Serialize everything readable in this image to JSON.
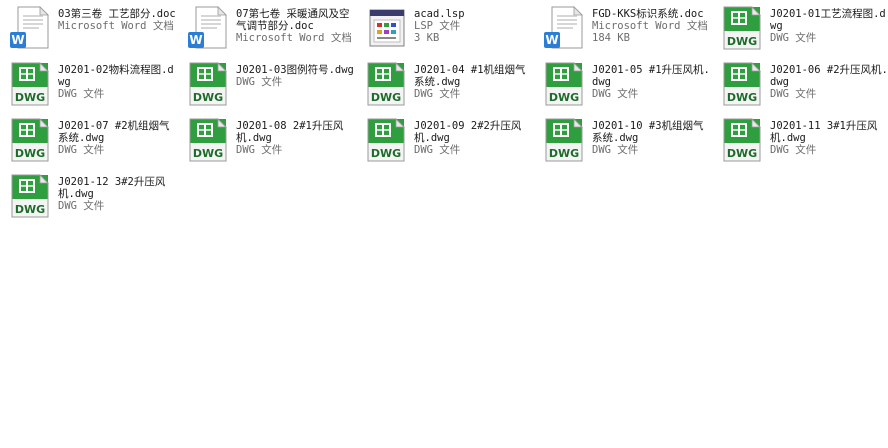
{
  "view": "explorer-tiles",
  "colors": {
    "name_text": "#1a1a1a",
    "meta_text": "#6d6d6d",
    "dwg_green": "#2e9e3e",
    "word_blue": "#2a7fd4"
  },
  "files": [
    {
      "name": "03第三卷 工艺部分.doc",
      "type": "Microsoft Word 文档",
      "size": "",
      "icon": "word-doc-icon"
    },
    {
      "name": "07第七卷 采暖通风及空气调节部分.doc",
      "type": "Microsoft Word 文档",
      "size": "",
      "icon": "word-doc-icon"
    },
    {
      "name": "acad.lsp",
      "type": "LSP 文件",
      "size": "3 KB",
      "icon": "lsp-file-icon"
    },
    {
      "name": "FGD-KKS标识系统.doc",
      "type": "Microsoft Word 文档",
      "size": "184 KB",
      "icon": "word-doc-icon"
    },
    {
      "name": "J0201-01工艺流程图.dwg",
      "type": "DWG 文件",
      "size": "",
      "icon": "dwg-file-icon"
    },
    {
      "name": "J0201-02物料流程图.dwg",
      "type": "DWG 文件",
      "size": "",
      "icon": "dwg-file-icon"
    },
    {
      "name": "J0201-03图例符号.dwg",
      "type": "DWG 文件",
      "size": "",
      "icon": "dwg-file-icon"
    },
    {
      "name": "J0201-04 #1机组烟气系统.dwg",
      "type": "DWG 文件",
      "size": "",
      "icon": "dwg-file-icon"
    },
    {
      "name": "J0201-05 #1升压风机.dwg",
      "type": "DWG 文件",
      "size": "",
      "icon": "dwg-file-icon"
    },
    {
      "name": "J0201-06 #2升压风机.dwg",
      "type": "DWG 文件",
      "size": "",
      "icon": "dwg-file-icon"
    },
    {
      "name": "J0201-07 #2机组烟气系统.dwg",
      "type": "DWG 文件",
      "size": "",
      "icon": "dwg-file-icon"
    },
    {
      "name": "J0201-08 2#1升压风机.dwg",
      "type": "DWG 文件",
      "size": "",
      "icon": "dwg-file-icon"
    },
    {
      "name": "J0201-09 2#2升压风机.dwg",
      "type": "DWG 文件",
      "size": "",
      "icon": "dwg-file-icon"
    },
    {
      "name": "J0201-10 #3机组烟气系统.dwg",
      "type": "DWG 文件",
      "size": "",
      "icon": "dwg-file-icon"
    },
    {
      "name": "J0201-11 3#1升压风机.dwg",
      "type": "DWG 文件",
      "size": "",
      "icon": "dwg-file-icon"
    },
    {
      "name": "J0201-12 3#2升压风机.dwg",
      "type": "DWG 文件",
      "size": "",
      "icon": "dwg-file-icon"
    }
  ]
}
